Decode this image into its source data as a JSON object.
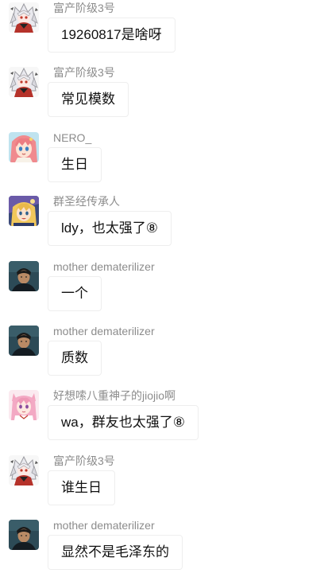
{
  "messages": [
    {
      "sender": "富产阶级3号",
      "avatar_icon": "white-hair-anime-girl-icon",
      "text": "19260817是啥呀"
    },
    {
      "sender": "富产阶级3号",
      "avatar_icon": "white-hair-anime-girl-icon",
      "text": "常见模数"
    },
    {
      "sender": "NERO_",
      "avatar_icon": "pink-hair-anime-girl-icon",
      "text": "生日"
    },
    {
      "sender": "群圣经传承人",
      "avatar_icon": "blonde-anime-girl-icon",
      "text": "ldy，也太强了⑧"
    },
    {
      "sender": "mother dematerilizer",
      "avatar_icon": "man-portrait-icon",
      "text": "一个"
    },
    {
      "sender": "mother dematerilizer",
      "avatar_icon": "man-portrait-icon",
      "text": "质数"
    },
    {
      "sender": "好想嗦八重神子的jiojio啊",
      "avatar_icon": "pink-fox-girl-icon",
      "text": "wa，群友也太强了⑧"
    },
    {
      "sender": "富产阶级3号",
      "avatar_icon": "white-hair-anime-girl-icon",
      "text": "谁生日"
    },
    {
      "sender": "mother dematerilizer",
      "avatar_icon": "man-portrait-icon",
      "text": "显然不是毛泽东的"
    }
  ],
  "colors": {
    "sender_name": "#8c8c8c",
    "bubble_background": "#ffffff",
    "bubble_border": "#eeeeee",
    "message_text": "#111111"
  }
}
